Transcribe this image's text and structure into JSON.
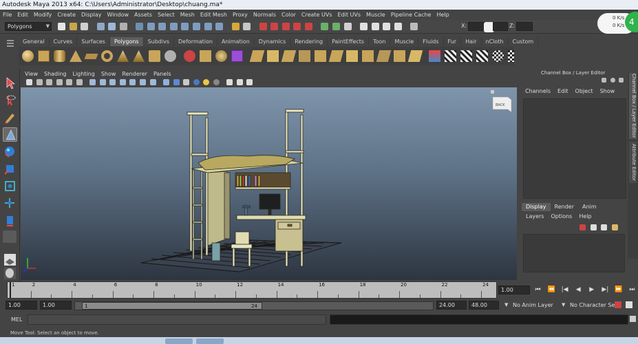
{
  "window": {
    "title": "Autodesk Maya 2013 x64: C:\\Users\\Administrator\\Desktop\\chuang.ma*"
  },
  "menubar": [
    "File",
    "Edit",
    "Modify",
    "Create",
    "Display",
    "Window",
    "Assets",
    "Select",
    "Mesh",
    "Edit Mesh",
    "Proxy",
    "Normals",
    "Color",
    "Create UVs",
    "Edit UVs",
    "Muscle",
    "Pipeline Cache",
    "Help"
  ],
  "statusline": {
    "menuset": "Polygons",
    "x_label": "X:",
    "z_label": "Z:"
  },
  "perf": {
    "line1": "0 K/s",
    "line2": "0 K/s",
    "badge": "4"
  },
  "shelf": {
    "tabs": [
      "General",
      "Curves",
      "Surfaces",
      "Polygons",
      "Subdivs",
      "Deformation",
      "Animation",
      "Dynamics",
      "Rendering",
      "PaintEffects",
      "Toon",
      "Muscle",
      "Fluids",
      "Fur",
      "Hair",
      "nCloth",
      "Custom"
    ],
    "active_tab": "Polygons"
  },
  "viewport": {
    "menu": [
      "View",
      "Shading",
      "Lighting",
      "Show",
      "Renderer",
      "Panels"
    ],
    "viewcube_label": "BACK"
  },
  "channelbox": {
    "header": "Channel Box / Layer Editor",
    "menu": [
      "Channels",
      "Edit",
      "Object",
      "Show"
    ],
    "side_tabs": [
      "Channel Box / Layer Editor",
      "Attribute Editor"
    ]
  },
  "layers": {
    "tabs": [
      "Display",
      "Render",
      "Anim"
    ],
    "active_tab": "Display",
    "menu": [
      "Layers",
      "Options",
      "Help"
    ]
  },
  "timeline": {
    "ticks": [
      "1",
      "2",
      "4",
      "6",
      "8",
      "10",
      "12",
      "14",
      "16",
      "18",
      "20",
      "22",
      "24"
    ],
    "current_frame": "1.00",
    "playback_buttons": [
      "⏮",
      "⏪",
      "|◀",
      "◀",
      "▶",
      "▶|",
      "⏩",
      "⏭"
    ]
  },
  "range": {
    "start": "1.00",
    "inner_start": "1.00",
    "handle_left": "1",
    "handle_right": "24",
    "inner_end": "24.00",
    "end": "48.00",
    "anim_layer": "No Anim Layer",
    "character_set": "No Character Set"
  },
  "mel": {
    "label": "MEL"
  },
  "status": {
    "help_text": "Move Tool: Select an object to move."
  },
  "colors": {
    "accent": "#2fb34a",
    "ui_bg": "#444444",
    "viewport_top": "#7f95ab",
    "viewport_bottom": "#2d3540"
  }
}
